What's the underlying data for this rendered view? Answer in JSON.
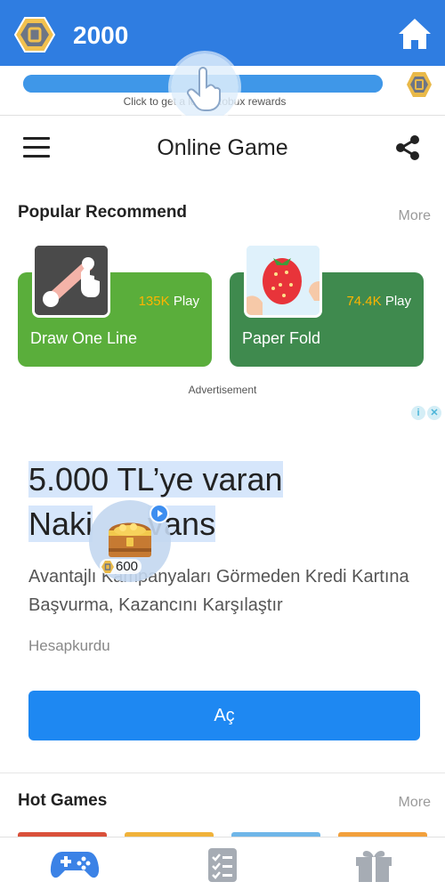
{
  "top_bar": {
    "balance": "2000",
    "coin_icon": "robux-coin-icon",
    "home_icon": "home-icon",
    "color": "#2f7de1"
  },
  "progress": {
    "fraction": 1.0,
    "caption": "Click to get a lot of Robux rewards",
    "coin_icon": "robux-coin-icon"
  },
  "header": {
    "menu_icon": "hamburger-menu-icon",
    "title": "Online Game",
    "share_icon": "share-icon"
  },
  "popular": {
    "title": "Popular Recommend",
    "more": "More",
    "games": [
      {
        "name": "Draw One Line",
        "plays": "135K",
        "play_label": "Play",
        "color": "#5aae3b"
      },
      {
        "name": "Paper Fold",
        "plays": "74.4K",
        "play_label": "Play",
        "color": "#3f8a4e"
      }
    ],
    "ad_label": "Advertisement"
  },
  "ad": {
    "headline_line1": "5.000 TL’ye varan",
    "headline_line2_a": "Naki",
    "headline_line2_b": "vans",
    "body": "Avantajlı Kampanyaları Görmeden Kredi Kartına Başvurma, Kazancını Karşılaştır",
    "source": "Hesapkurdu",
    "cta": "Aç",
    "cta_color": "#1e88f2"
  },
  "chest": {
    "count": "600",
    "icon": "treasure-chest-icon"
  },
  "hot": {
    "title": "Hot Games",
    "more": "More"
  },
  "bottom_nav": {
    "items": [
      {
        "icon": "gamepad-icon",
        "active": true
      },
      {
        "icon": "task-list-icon",
        "active": false
      },
      {
        "icon": "gift-icon",
        "active": false
      }
    ]
  }
}
